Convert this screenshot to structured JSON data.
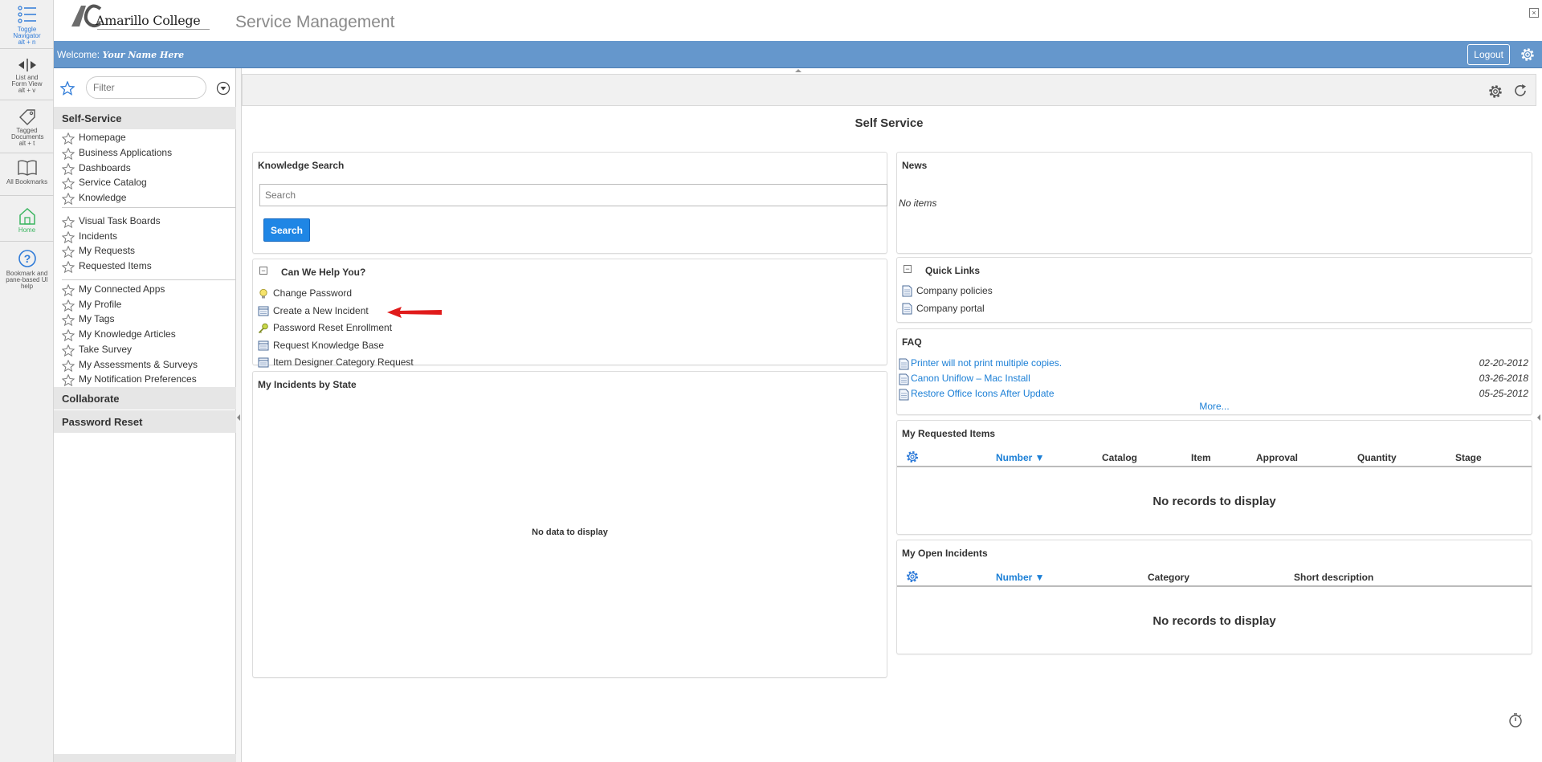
{
  "rail": {
    "toggle_navigator": {
      "label": "Toggle Navigator",
      "key": "alt + n"
    },
    "list_form_view": {
      "label": "List and Form View",
      "key": "alt + v"
    },
    "tagged_documents": {
      "label": "Tagged Documents",
      "key": "alt + t"
    },
    "all_bookmarks": {
      "label": "All Bookmarks"
    },
    "home": {
      "label": "Home"
    },
    "bookmark_help": {
      "label": "Bookmark and pane-based UI help"
    }
  },
  "header": {
    "logo_text": "Amarillo College",
    "app_title": "Service Management",
    "close_glyph": "×"
  },
  "topbar": {
    "welcome_label": "Welcome:",
    "user_name": "Your Name Here",
    "logout_label": "Logout"
  },
  "nav": {
    "filter_placeholder": "Filter",
    "sections": [
      {
        "label": "Self-Service"
      },
      {
        "label": "Collaborate"
      },
      {
        "label": "Password Reset"
      }
    ],
    "items": [
      {
        "label": "Homepage"
      },
      {
        "label": "Business Applications"
      },
      {
        "label": "Dashboards"
      },
      {
        "label": "Service Catalog"
      },
      {
        "label": "Knowledge"
      },
      {
        "label": "Visual Task Boards"
      },
      {
        "label": "Incidents"
      },
      {
        "label": "My Requests"
      },
      {
        "label": "Requested Items"
      },
      {
        "label": "My Connected Apps"
      },
      {
        "label": "My Profile"
      },
      {
        "label": "My Tags"
      },
      {
        "label": "My Knowledge Articles"
      },
      {
        "label": "Take Survey"
      },
      {
        "label": "My Assessments & Surveys"
      },
      {
        "label": "My Notification Preferences"
      }
    ]
  },
  "page": {
    "title": "Self Service"
  },
  "knowledge_search": {
    "title": "Knowledge Search",
    "placeholder": "Search",
    "button_label": "Search"
  },
  "help": {
    "title": "Can We Help You?",
    "collapse_glyph": "−",
    "links": [
      {
        "label": "Change Password",
        "icon": "lightbulb-icon"
      },
      {
        "label": "Create a New Incident",
        "icon": "form-icon"
      },
      {
        "label": "Password Reset Enrollment",
        "icon": "key-icon"
      },
      {
        "label": "Request Knowledge Base",
        "icon": "form-icon"
      },
      {
        "label": "Item Designer Category Request",
        "icon": "form-icon"
      }
    ]
  },
  "incidents_by_state": {
    "title": "My Incidents by State",
    "empty": "No data to display"
  },
  "news": {
    "title": "News",
    "empty": "No items"
  },
  "quick_links": {
    "title": "Quick Links",
    "collapse_glyph": "−",
    "items": [
      {
        "label": "Company policies"
      },
      {
        "label": "Company portal"
      }
    ]
  },
  "faq": {
    "title": "FAQ",
    "items": [
      {
        "label": "Printer will not print multiple copies.",
        "date": "02-20-2012"
      },
      {
        "label": "Canon Uniflow – Mac Install",
        "date": "03-26-2018"
      },
      {
        "label": "Restore Office Icons After Update",
        "date": "05-25-2012"
      }
    ],
    "more": "More..."
  },
  "requested_items": {
    "title": "My Requested Items",
    "columns": [
      "Number ▼",
      "Catalog",
      "Item",
      "Approval",
      "Quantity",
      "Stage"
    ],
    "empty": "No records to display"
  },
  "open_incidents": {
    "title": "My Open Incidents",
    "columns": [
      "Number ▼",
      "Category",
      "Short description"
    ],
    "empty": "No records to display"
  },
  "colors": {
    "topbar": "#6597cc",
    "primary_button": "#1f86e5",
    "link": "#1b7fd6",
    "arrow": "#e01b1b"
  }
}
